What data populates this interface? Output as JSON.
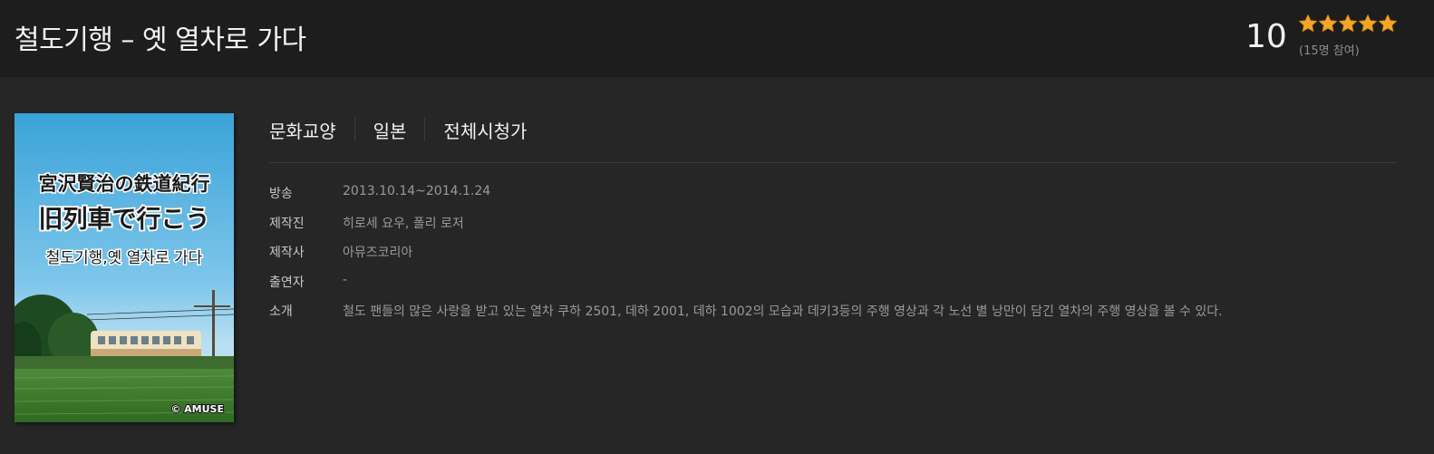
{
  "header": {
    "title": "철도기행 – 옛 열차로 가다",
    "score": "10",
    "rating_stars": 5,
    "rating_max": 5,
    "star_color": "#f5a623",
    "participants": "(15명 참여)"
  },
  "poster": {
    "title_line1": "宮沢賢治の鉄道紀行",
    "title_line2": "旧列車で行こう",
    "subtitle": "철도기행,옛 열차로 가다",
    "credit": "© AMUSE"
  },
  "tags": [
    "문화교양",
    "일본",
    "전체시청가"
  ],
  "info": [
    {
      "label": "방송",
      "value": "2013.10.14~2014.1.24"
    },
    {
      "label": "제작진",
      "value": "히로세 요우, 폴리 로저"
    },
    {
      "label": "제작사",
      "value": "아뮤즈코리아"
    },
    {
      "label": "출연자",
      "value": "-"
    },
    {
      "label": "소개",
      "value": "철도 팬들의 많은 사랑을 받고 있는 열차 쿠하 2501, 데하 2001, 데하 1002의 모습과 데키3등의 주행 영상과 각 노선 별 낭만이 담긴 열차의 주행 영상을 볼 수 있다."
    }
  ]
}
